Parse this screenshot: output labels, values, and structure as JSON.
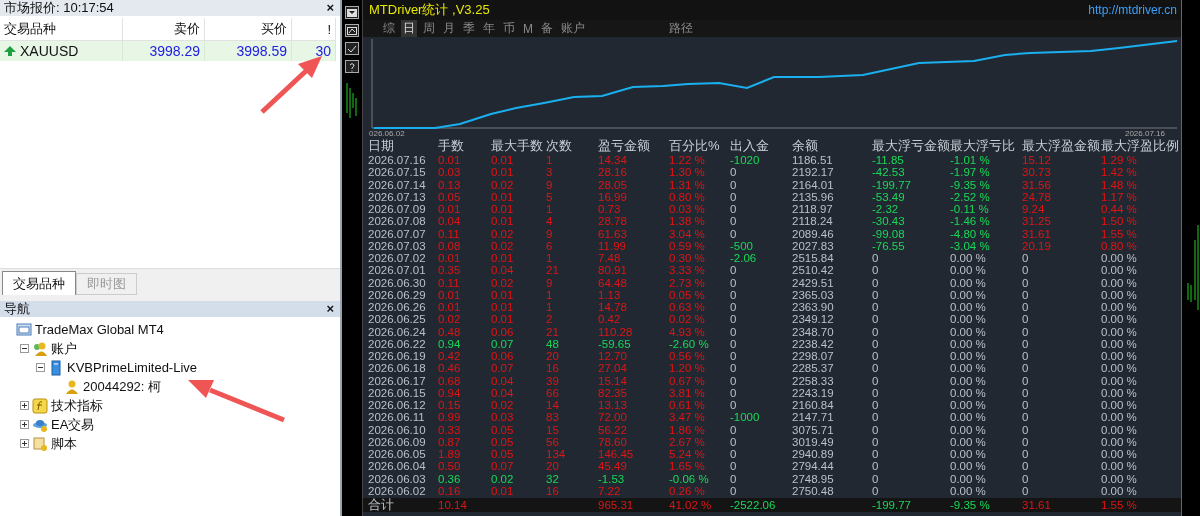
{
  "market_watch": {
    "title": "市场报价: 10:17:54",
    "close": "×",
    "columns": [
      "交易品种",
      "卖价",
      "买价",
      "!"
    ],
    "rows": [
      {
        "symbol": "XAUUSD",
        "rising": true,
        "bid": "3998.29",
        "ask": "3998.59",
        "spread": "30"
      }
    ]
  },
  "tabs": [
    {
      "label": "交易品种",
      "selected": true
    },
    {
      "label": "即时图",
      "selected": false
    }
  ],
  "navigator": {
    "title": "导航",
    "close": "×",
    "tree": [
      {
        "label": "TradeMax Global MT4",
        "kind": "terminal",
        "children": [
          {
            "label": "账户",
            "kind": "accounts",
            "expanded": true,
            "children": [
              {
                "label": "KVBPrimeLimited-Live",
                "kind": "server",
                "expanded": true,
                "children": [
                  {
                    "label": "20044292: 柯",
                    "kind": "account"
                  }
                ]
              }
            ]
          },
          {
            "label": "技术指标",
            "kind": "indicators",
            "expanded": false
          },
          {
            "label": "EA交易",
            "kind": "experts",
            "expanded": false
          },
          {
            "label": "脚本",
            "kind": "scripts",
            "expanded": false
          }
        ]
      }
    ]
  },
  "stats_panel": {
    "title": "MTDriver统计 ,V3.25",
    "url": "http://mtdriver.cn",
    "periods": [
      {
        "label": "综",
        "selected": false
      },
      {
        "label": "日",
        "selected": true
      },
      {
        "label": "周",
        "selected": false
      },
      {
        "label": "月",
        "selected": false
      },
      {
        "label": "季",
        "selected": false
      },
      {
        "label": "年",
        "selected": false
      },
      {
        "label": "币",
        "selected": false
      },
      {
        "label": "M",
        "selected": false
      },
      {
        "label": "备",
        "selected": false
      },
      {
        "label": "账户",
        "selected": false
      }
    ],
    "path_button": "路径",
    "equity_chart": {
      "start_label": "026.06.02",
      "end_label": "2026.07.16"
    },
    "columns": [
      "日期",
      "手数",
      "最大手数",
      "次数",
      "盈亏金额",
      "百分比%",
      "出入金",
      "余额",
      "最大浮亏金额",
      "最大浮亏比",
      "最大浮盈金额",
      "最大浮盈比例"
    ],
    "rows": [
      {
        "cells": [
          "2026.07.16",
          "0.01",
          "0.01",
          "1",
          "14.34",
          "1.22 %",
          "-1020",
          "1186.51",
          "-11.85",
          "-1.01 %",
          "15.12",
          "1.29 %"
        ],
        "loss": false,
        "cash_flow": true,
        "floating": true
      },
      {
        "cells": [
          "2026.07.15",
          "0.03",
          "0.01",
          "3",
          "28.16",
          "1.30 %",
          "0",
          "2192.17",
          "-42.53",
          "-1.97 %",
          "30.73",
          "1.42 %"
        ],
        "loss": false,
        "cash_flow": false,
        "floating": true
      },
      {
        "cells": [
          "2026.07.14",
          "0.13",
          "0.02",
          "9",
          "28.05",
          "1.31 %",
          "0",
          "2164.01",
          "-199.77",
          "-9.35 %",
          "31.56",
          "1.48 %"
        ],
        "loss": false,
        "cash_flow": false,
        "floating": true
      },
      {
        "cells": [
          "2026.07.13",
          "0.05",
          "0.01",
          "5",
          "16.99",
          "0.80 %",
          "0",
          "2135.96",
          "-53.49",
          "-2.52 %",
          "24.78",
          "1.17 %"
        ],
        "loss": false,
        "cash_flow": false,
        "floating": true
      },
      {
        "cells": [
          "2026.07.09",
          "0.01",
          "0.01",
          "1",
          "0.73",
          "0.03 %",
          "0",
          "2118.97",
          "-2.32",
          "-0.11 %",
          "9.24",
          "0.44 %"
        ],
        "loss": false,
        "cash_flow": false,
        "floating": true
      },
      {
        "cells": [
          "2026.07.08",
          "0.04",
          "0.01",
          "4",
          "28.78",
          "1.38 %",
          "0",
          "2118.24",
          "-30.43",
          "-1.46 %",
          "31.25",
          "1.50 %"
        ],
        "loss": false,
        "cash_flow": false,
        "floating": true
      },
      {
        "cells": [
          "2026.07.07",
          "0.11",
          "0.02",
          "9",
          "61.63",
          "3.04 %",
          "0",
          "2089.46",
          "-99.08",
          "-4.80 %",
          "31.61",
          "1.55 %"
        ],
        "loss": false,
        "cash_flow": false,
        "floating": true
      },
      {
        "cells": [
          "2026.07.03",
          "0.08",
          "0.02",
          "6",
          "11.99",
          "0.59 %",
          "-500",
          "2027.83",
          "-76.55",
          "-3.04 %",
          "20.19",
          "0.80 %"
        ],
        "loss": false,
        "cash_flow": true,
        "floating": true
      },
      {
        "cells": [
          "2026.07.02",
          "0.01",
          "0.01",
          "1",
          "7.48",
          "0.30 %",
          "-2.06",
          "2515.84",
          "0",
          "0.00 %",
          "0",
          "0.00 %"
        ],
        "loss": false,
        "cash_flow": true,
        "floating": false
      },
      {
        "cells": [
          "2026.07.01",
          "0.35",
          "0.04",
          "21",
          "80.91",
          "3.33 %",
          "0",
          "2510.42",
          "0",
          "0.00 %",
          "0",
          "0.00 %"
        ],
        "loss": false,
        "cash_flow": false,
        "floating": false
      },
      {
        "cells": [
          "2026.06.30",
          "0.11",
          "0.02",
          "9",
          "64.48",
          "2.73 %",
          "0",
          "2429.51",
          "0",
          "0.00 %",
          "0",
          "0.00 %"
        ],
        "loss": false,
        "cash_flow": false,
        "floating": false
      },
      {
        "cells": [
          "2026.06.29",
          "0.01",
          "0.01",
          "1",
          "1.13",
          "0.05 %",
          "0",
          "2365.03",
          "0",
          "0.00 %",
          "0",
          "0.00 %"
        ],
        "loss": false,
        "cash_flow": false,
        "floating": false
      },
      {
        "cells": [
          "2026.06.26",
          "0.01",
          "0.01",
          "1",
          "14.78",
          "0.63 %",
          "0",
          "2363.90",
          "0",
          "0.00 %",
          "0",
          "0.00 %"
        ],
        "loss": false,
        "cash_flow": false,
        "floating": false
      },
      {
        "cells": [
          "2026.06.25",
          "0.02",
          "0.01",
          "2",
          "0.42",
          "0.02 %",
          "0",
          "2349.12",
          "0",
          "0.00 %",
          "0",
          "0.00 %"
        ],
        "loss": false,
        "cash_flow": false,
        "floating": false
      },
      {
        "cells": [
          "2026.06.24",
          "0.48",
          "0.06",
          "21",
          "110.28",
          "4.93 %",
          "0",
          "2348.70",
          "0",
          "0.00 %",
          "0",
          "0.00 %"
        ],
        "loss": false,
        "cash_flow": false,
        "floating": false
      },
      {
        "cells": [
          "2026.06.22",
          "0.94",
          "0.07",
          "48",
          "-59.65",
          "-2.60 %",
          "0",
          "2238.42",
          "0",
          "0.00 %",
          "0",
          "0.00 %"
        ],
        "loss": true,
        "cash_flow": false,
        "floating": false
      },
      {
        "cells": [
          "2026.06.19",
          "0.42",
          "0.06",
          "20",
          "12.70",
          "0.56 %",
          "0",
          "2298.07",
          "0",
          "0.00 %",
          "0",
          "0.00 %"
        ],
        "loss": false,
        "cash_flow": false,
        "floating": false
      },
      {
        "cells": [
          "2026.06.18",
          "0.46",
          "0.07",
          "16",
          "27.04",
          "1.20 %",
          "0",
          "2285.37",
          "0",
          "0.00 %",
          "0",
          "0.00 %"
        ],
        "loss": false,
        "cash_flow": false,
        "floating": false
      },
      {
        "cells": [
          "2026.06.17",
          "0.68",
          "0.04",
          "39",
          "15.14",
          "0.67 %",
          "0",
          "2258.33",
          "0",
          "0.00 %",
          "0",
          "0.00 %"
        ],
        "loss": false,
        "cash_flow": false,
        "floating": false
      },
      {
        "cells": [
          "2026.06.15",
          "0.94",
          "0.04",
          "66",
          "82.35",
          "3.81 %",
          "0",
          "2243.19",
          "0",
          "0.00 %",
          "0",
          "0.00 %"
        ],
        "loss": false,
        "cash_flow": false,
        "floating": false
      },
      {
        "cells": [
          "2026.06.12",
          "0.15",
          "0.02",
          "14",
          "13.13",
          "0.61 %",
          "0",
          "2160.84",
          "0",
          "0.00 %",
          "0",
          "0.00 %"
        ],
        "loss": false,
        "cash_flow": false,
        "floating": false
      },
      {
        "cells": [
          "2026.06.11",
          "0.99",
          "0.03",
          "83",
          "72.00",
          "3.47 %",
          "-1000",
          "2147.71",
          "0",
          "0.00 %",
          "0",
          "0.00 %"
        ],
        "loss": false,
        "cash_flow": true,
        "floating": false
      },
      {
        "cells": [
          "2026.06.10",
          "0.33",
          "0.05",
          "15",
          "56.22",
          "1.86 %",
          "0",
          "3075.71",
          "0",
          "0.00 %",
          "0",
          "0.00 %"
        ],
        "loss": false,
        "cash_flow": false,
        "floating": false
      },
      {
        "cells": [
          "2026.06.09",
          "0.87",
          "0.05",
          "56",
          "78.60",
          "2.67 %",
          "0",
          "3019.49",
          "0",
          "0.00 %",
          "0",
          "0.00 %"
        ],
        "loss": false,
        "cash_flow": false,
        "floating": false
      },
      {
        "cells": [
          "2026.06.05",
          "1.89",
          "0.05",
          "134",
          "146.45",
          "5.24 %",
          "0",
          "2940.89",
          "0",
          "0.00 %",
          "0",
          "0.00 %"
        ],
        "loss": false,
        "cash_flow": false,
        "floating": false
      },
      {
        "cells": [
          "2026.06.04",
          "0.50",
          "0.07",
          "20",
          "45.49",
          "1.65 %",
          "0",
          "2794.44",
          "0",
          "0.00 %",
          "0",
          "0.00 %"
        ],
        "loss": false,
        "cash_flow": false,
        "floating": false
      },
      {
        "cells": [
          "2026.06.03",
          "0.36",
          "0.02",
          "32",
          "-1.53",
          "-0.06 %",
          "0",
          "2748.95",
          "0",
          "0.00 %",
          "0",
          "0.00 %"
        ],
        "loss": true,
        "cash_flow": false,
        "floating": false
      },
      {
        "cells": [
          "2026.06.02",
          "0.16",
          "0.01",
          "16",
          "7.22",
          "0.26 %",
          "0",
          "2750.48",
          "0",
          "0.00 %",
          "0",
          "0.00 %"
        ],
        "loss": false,
        "cash_flow": false,
        "floating": false
      }
    ],
    "total": {
      "label": "合计",
      "lots": "10.14",
      "pnl": "965.31",
      "pct": "41.02 %",
      "cash": "-2522.06",
      "float_loss": "-199.77",
      "float_loss_pct": "-9.35 %",
      "float_gain": "31.61",
      "float_gain_pct": "1.55 %"
    }
  }
}
